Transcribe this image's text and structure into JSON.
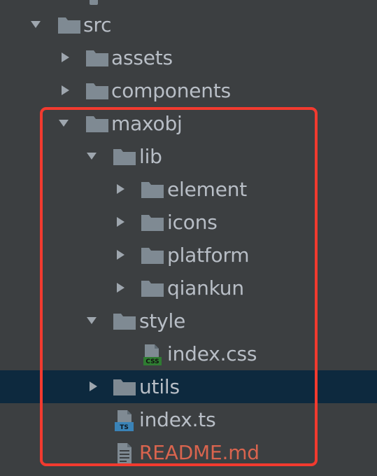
{
  "tree": {
    "items": [
      {
        "label": "src",
        "type": "folder",
        "expanded": true
      },
      {
        "label": "assets",
        "type": "folder",
        "expanded": false
      },
      {
        "label": "components",
        "type": "folder",
        "expanded": false
      },
      {
        "label": "maxobj",
        "type": "folder",
        "expanded": true
      },
      {
        "label": "lib",
        "type": "folder",
        "expanded": true
      },
      {
        "label": "element",
        "type": "folder",
        "expanded": false
      },
      {
        "label": "icons",
        "type": "folder",
        "expanded": false
      },
      {
        "label": "platform",
        "type": "folder",
        "expanded": false
      },
      {
        "label": "qiankun",
        "type": "folder",
        "expanded": false
      },
      {
        "label": "style",
        "type": "folder",
        "expanded": true
      },
      {
        "label": "index.css",
        "type": "file",
        "file_badge": "css"
      },
      {
        "label": "utils",
        "type": "folder",
        "expanded": false,
        "selected": true
      },
      {
        "label": "index.ts",
        "type": "file",
        "file_badge": "TS"
      },
      {
        "label": "README.md",
        "type": "file",
        "file_badge": ""
      }
    ]
  },
  "colors": {
    "background": "#3c3f41",
    "selected_row": "#0d293e",
    "text": "#b8bec6",
    "folder": "#7f8a93",
    "chevron": "#9ea6ae",
    "highlight_border": "#f23a2f",
    "readme_text": "#d9644e",
    "css_badge": "#2f7d32",
    "ts_badge": "#3a83b7"
  },
  "icons": {
    "folder": "folder-icon",
    "expanded": "chevron-down-icon",
    "collapsed": "chevron-right-icon",
    "css_file": "css-file-icon",
    "ts_file": "ts-file-icon",
    "markdown_file": "markdown-file-icon"
  }
}
